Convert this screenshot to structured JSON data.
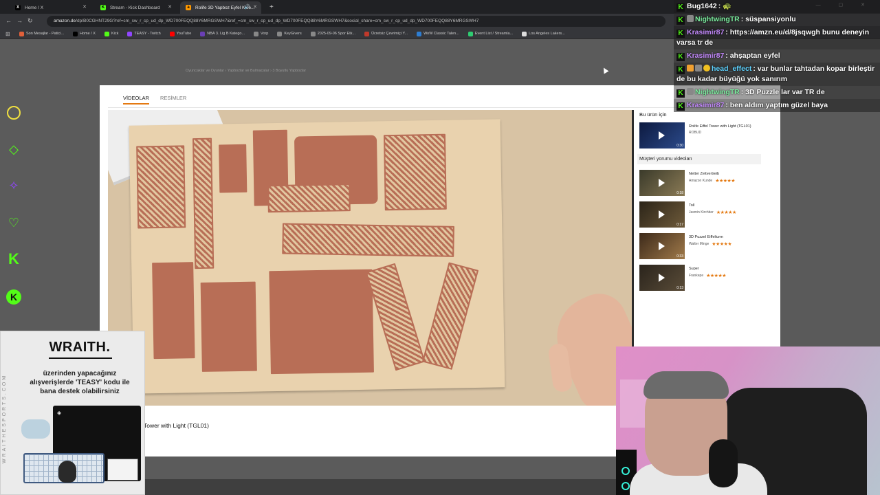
{
  "browser": {
    "tabs": [
      {
        "label": "Home / X",
        "icon": "x-logo-icon",
        "color": "#000000"
      },
      {
        "label": "Stream - Kick Dashboard",
        "icon": "kick-logo-icon",
        "color": "#53fc18"
      },
      {
        "label": "Rolife 3D Yapboz Eyfel Kule...",
        "icon": "amazon-logo-icon",
        "color": "#ff9900",
        "active": true
      }
    ],
    "url_host": "amazon.de",
    "url_path": "/dp/B0CGHNT29G?ref=cm_sw_r_cp_ud_dp_WD700FEQQ88Y6MRGSWH7&ref_=cm_sw_r_cp_ud_dp_WD700FEQQ88Y6MRGSWH7&social_share=cm_sw_r_cp_ud_dp_WD700FEQQ88Y6MRGSWH7",
    "bookmarks": [
      {
        "label": "Son Mesajlar - Patici...",
        "color": "#e0603a"
      },
      {
        "label": "Home / X",
        "color": "#000000"
      },
      {
        "label": "Kick",
        "color": "#53fc18"
      },
      {
        "label": "TEASY - Twitch",
        "color": "#9146ff"
      },
      {
        "label": "YouTube",
        "color": "#ff0000"
      },
      {
        "label": "NBA 3. Lig B Katego...",
        "color": "#6a3fb5"
      },
      {
        "label": "Vorp",
        "color": "#888888"
      },
      {
        "label": "KeyGivers",
        "color": "#888888"
      },
      {
        "label": "2025-09-06 Spor Etk...",
        "color": "#888888"
      },
      {
        "label": "Ücretsiz Çevrimiçi Y...",
        "color": "#c0392b"
      },
      {
        "label": "WoW Classic Talen...",
        "color": "#2d7dd2"
      },
      {
        "label": "Event List / Streamla...",
        "color": "#2ecc71"
      },
      {
        "label": "Los Angeles Lakers...",
        "color": "#dddddd"
      }
    ],
    "all_bookmarks": "Tüm Yer İşaretleri"
  },
  "amazon": {
    "breadcrumb": "Oyuncaklar ve Oyunlar › Yapbozlar ve Bulmacalar › 3 Boyutlu Yapbozlar",
    "modal_tabs": [
      "VİDEOLAR",
      "RESİMLER"
    ],
    "caption": "Tower with Light (TGL01)",
    "side_title": "Bu ürün için",
    "featured_video": {
      "title": "Rolife Eiffel Tower with Light (TGL01)",
      "author": "ROBUD",
      "duration": "0:30"
    },
    "customer_section": "Müşteri yorumu videoları",
    "customer_videos": [
      {
        "title": "Netter Zeitvertreib",
        "author": "Amazon Kunde",
        "duration": "0:18",
        "stars": "★★★★★"
      },
      {
        "title": "Toll",
        "author": "Jasmin Kirchber",
        "duration": "0:17",
        "stars": "★★★★★"
      },
      {
        "title": "3D Puzzel Eiffelturm",
        "author": "Walter Minge",
        "duration": "0:33",
        "stars": "★★★★★"
      },
      {
        "title": "Super",
        "author": "Frankepe",
        "duration": "0:13",
        "stars": "★★★★★"
      }
    ]
  },
  "chat": [
    {
      "user": "Bug1642",
      "color": "#ffffff",
      "message": ": 🐢"
    },
    {
      "user": "NightwingTR",
      "color": "#7cf0a0",
      "message": ": süspansiyonlu"
    },
    {
      "user": "Krasimir87",
      "color": "#c58bff",
      "message": ": https://amzn.eu/d/8jsqwgh bunu deneyin varsa tr de"
    },
    {
      "user": "Krasimir87",
      "color": "#c58bff",
      "message": ": ahşaptan eyfel"
    },
    {
      "user": "head_effect",
      "color": "#5fd3ff",
      "message": ": var bunlar tahtadan kopar birleştir de bu kadar büyüğü yok sanırım"
    },
    {
      "user": "NightwingTR",
      "color": "#7cf0a0",
      "message": ": 3D Puzzle lar var TR de"
    },
    {
      "user": "Krasimir87",
      "color": "#c58bff",
      "message": ": ben aldım yaptım güzel baya"
    }
  ],
  "ad": {
    "brand": "WRAITH.",
    "message": "üzerinden yapacağınız alışverişlerde 'TEASY' kodu ile bana destek olabilirsiniz",
    "site": "WRAITHESPORTS.COM"
  },
  "colors": {
    "kick_green": "#53fc18",
    "amazon_orange": "#e47911"
  }
}
